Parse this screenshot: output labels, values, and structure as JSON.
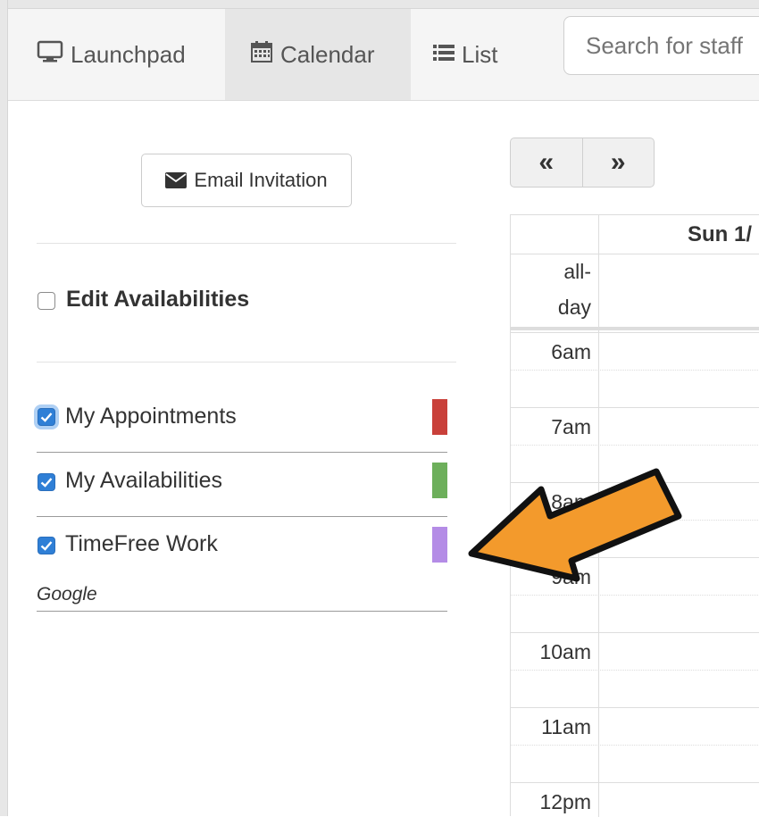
{
  "nav": {
    "launchpad": "Launchpad",
    "calendar": "Calendar",
    "list": "List",
    "search_placeholder": "Search for staff",
    "active_tab": "calendar"
  },
  "sidebar": {
    "email_invitation": "Email Invitation",
    "edit_availabilities": {
      "label": "Edit Availabilities",
      "checked": false
    },
    "calendars": [
      {
        "label": "My Appointments",
        "checked": true,
        "color": "#c9403a"
      },
      {
        "label": "My Availabilities",
        "checked": true,
        "color": "#6daf5b"
      },
      {
        "label": "TimeFree Work",
        "checked": true,
        "color": "#b48ce6"
      }
    ],
    "group_label": "Google"
  },
  "calendar": {
    "prev": "«",
    "next": "»",
    "day_header": "Sun 1/",
    "allday_line1": "all-",
    "allday_line2": "day",
    "times": [
      "6am",
      "7am",
      "8am",
      "9am",
      "10am",
      "11am",
      "12pm"
    ]
  },
  "overlay": {
    "arrow_color": "#f39a2c",
    "icon": "pointing-arrow-icon"
  }
}
